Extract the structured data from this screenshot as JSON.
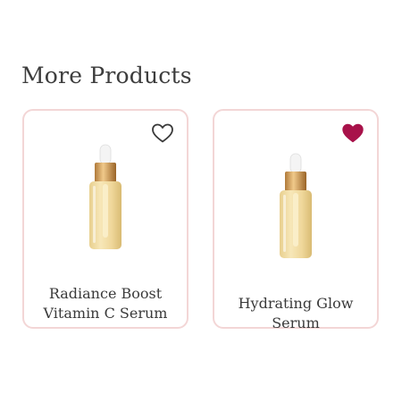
{
  "section": {
    "title": "More Products"
  },
  "products": [
    {
      "name": "Radiance Boost Vitamin C Serum",
      "image_icon": "serum-bottle-icon",
      "favorite": false,
      "favorite_icon": "heart-outline-icon"
    },
    {
      "name": "Hydrating Glow Serum",
      "image_icon": "serum-bottle-icon",
      "favorite": true,
      "favorite_icon": "heart-filled-icon"
    }
  ],
  "colors": {
    "card_border": "#f3d6d6",
    "heart_filled": "#a8124a",
    "heart_outline": "#3a3a3a",
    "text": "#3a3a3a"
  }
}
